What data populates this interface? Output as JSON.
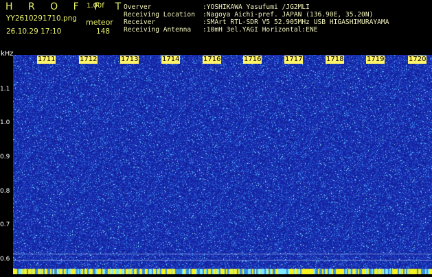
{
  "header": {
    "app_title": "H R O F F T",
    "version": "1.00f",
    "filename": "YY2610291710.png",
    "mode": "meteor",
    "datetime": "26.10.29 17:10",
    "count": "148"
  },
  "info": [
    {
      "key": "Overver",
      "value": ":YOSHIKAWA Yasufumi /JG2MLI"
    },
    {
      "key": "Receiving Location",
      "value": ":Nagoya Aichi-pref. JAPAN (136.90E, 35.20N)"
    },
    {
      "key": "Receiver",
      "value": ":SMArt RTL-SDR V5 52.905MHz USB HIGASHIMURAYAMA"
    },
    {
      "key": "Receiving Antenna",
      "value": ":10mH 3el.YAGI Horizontal:ENE"
    }
  ],
  "axis": {
    "unit": "kHz",
    "y_ticks": [
      "1.1",
      "1.0",
      "0.9",
      "0.8",
      "0.7",
      "0.6"
    ],
    "x_ticks": [
      "1711",
      "1712",
      "1713",
      "1714",
      "1716",
      "1716",
      "1717",
      "1718",
      "1719",
      "1720"
    ]
  },
  "colors": {
    "background": "#000000",
    "spectrum_base": "#1a2db0",
    "noise_light": "#4fc3ff",
    "noise_cyan": "#7de8ff",
    "bottom_strip": "#f7f320",
    "header_text": "#e8f26a"
  }
}
